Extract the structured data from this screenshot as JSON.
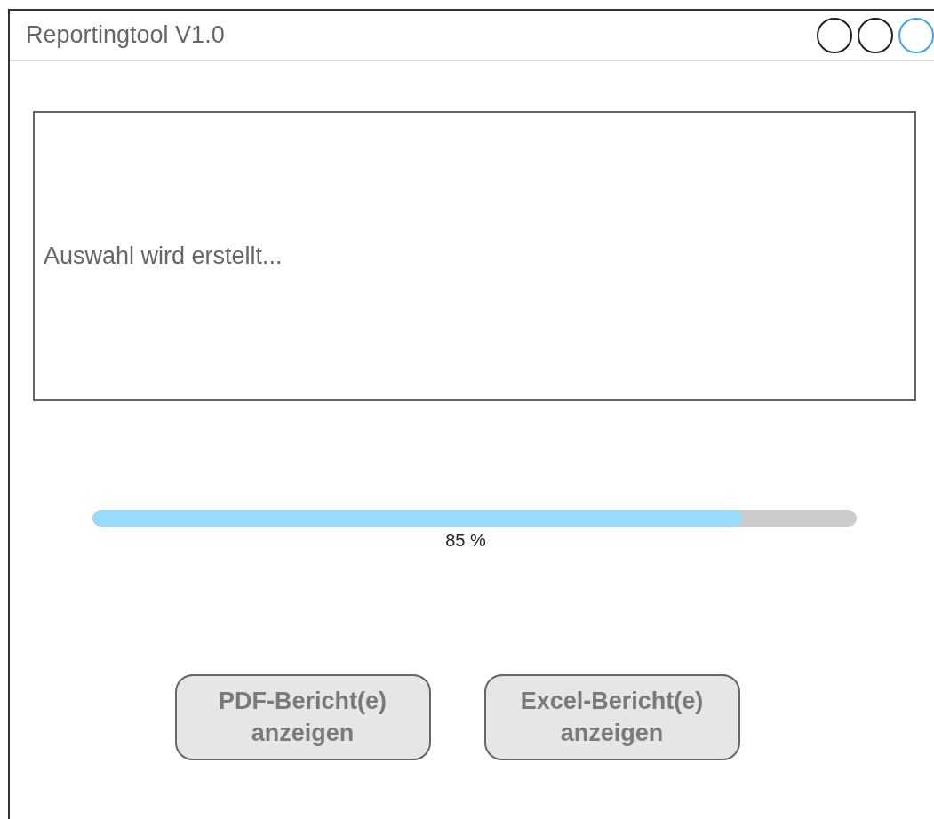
{
  "window": {
    "title": "Reportingtool V1.0",
    "controls": [
      {
        "color": "#222222"
      },
      {
        "color": "#222222"
      },
      {
        "color": "#3fa3f5"
      }
    ]
  },
  "message": {
    "text": "Auswahl wird erstellt..."
  },
  "progress": {
    "level": 0.85,
    "reading": "85 %"
  },
  "buttons": [
    {
      "label": "PDF-Bericht(e) anzeigen",
      "disabled": true
    },
    {
      "label": "Excel-Bericht(e) anzeigen",
      "disabled": true
    }
  ]
}
